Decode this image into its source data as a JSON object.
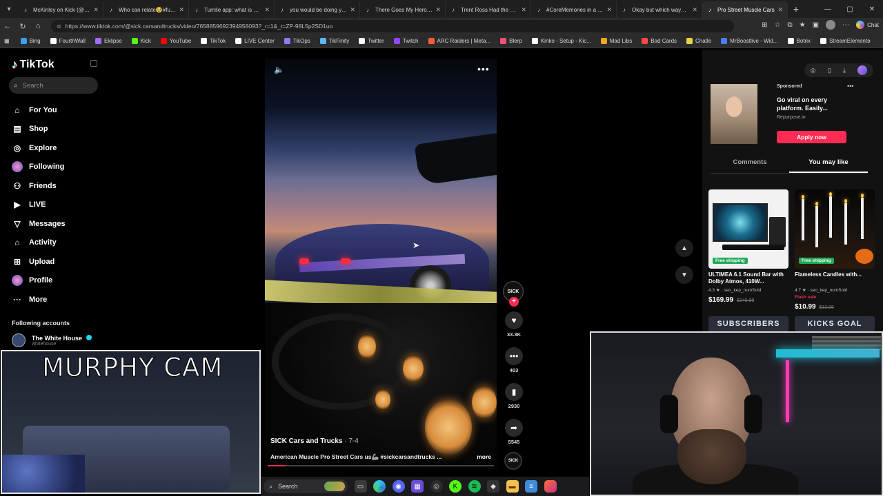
{
  "browser": {
    "tabs": [
      {
        "title": "McKinley on Kick (@mckin",
        "favicon": "tiktok-icon",
        "active": false
      },
      {
        "title": "Who can relate🥹#funny #",
        "favicon": "tiktok-icon",
        "active": false
      },
      {
        "title": "Turnile app: what is Turnil",
        "favicon": "tiktok-icon",
        "active": false
      },
      {
        "title": "you would be doing yours",
        "favicon": "tiktok-icon",
        "active": false
      },
      {
        "title": "There Goes My Hero — Sc",
        "favicon": "tiktok-icon",
        "active": false
      },
      {
        "title": "Trent Ross Had the Wheel",
        "favicon": "tiktok-icon",
        "active": false
      },
      {
        "title": "#CoreMemories in a #Lam",
        "favicon": "tiktok-icon",
        "active": false
      },
      {
        "title": "Okay but which way?? I go",
        "favicon": "tiktok-icon",
        "active": false
      },
      {
        "title": "Pro Street Muscle Cars",
        "favicon": "tiktok-icon",
        "active": true
      }
    ],
    "url": "https://www.tiktok.com/@sick.carsandtrucks/video/7658859692394958093?_r=1&_t=ZP-98L5p2SD1uo",
    "chat_label": "Chat",
    "bookmarks": [
      {
        "label": "Bing",
        "icon": "bing-icon",
        "color": "#3aa0ff"
      },
      {
        "label": "FourthWall",
        "icon": "fourthwall-icon",
        "color": "#ffffff"
      },
      {
        "label": "Eklipse",
        "icon": "eklipse-icon",
        "color": "#a66bff"
      },
      {
        "label": "Kick",
        "icon": "kick-icon",
        "color": "#53fc18"
      },
      {
        "label": "YouTube",
        "icon": "youtube-icon",
        "color": "#ff0000"
      },
      {
        "label": "TikTok",
        "icon": "tiktok-icon",
        "color": "#ffffff"
      },
      {
        "label": "LIVE Center",
        "icon": "tiktok-icon",
        "color": "#ffffff"
      },
      {
        "label": "TikOps",
        "icon": "tikops-icon",
        "color": "#8c7bff"
      },
      {
        "label": "TikFinity",
        "icon": "tikfinity-icon",
        "color": "#5bb8ff"
      },
      {
        "label": "Twitter",
        "icon": "x-icon",
        "color": "#ffffff"
      },
      {
        "label": "Twitch",
        "icon": "twitch-icon",
        "color": "#9146ff"
      },
      {
        "label": "ARC Raiders | Meta...",
        "icon": "arc-icon",
        "color": "#ff5a3c"
      },
      {
        "label": "Blerp",
        "icon": "blerp-icon",
        "color": "#ff4f7a"
      },
      {
        "label": "Kinko - Setup - Kic...",
        "icon": "kinko-icon",
        "color": "#ffffff"
      },
      {
        "label": "Mad Libs",
        "icon": "madlibs-icon",
        "color": "#f6a623"
      },
      {
        "label": "Bad Cards",
        "icon": "badcards-icon",
        "color": "#ff4848"
      },
      {
        "label": "Chatle",
        "icon": "chatle-icon",
        "color": "#e7d34a"
      },
      {
        "label": "MrBoostlive - Wid...",
        "icon": "mrboost-icon",
        "color": "#4a7dff"
      },
      {
        "label": "Botrix",
        "icon": "botrix-icon",
        "color": "#ffffff"
      },
      {
        "label": "StreamElements",
        "icon": "streamelements-icon",
        "color": "#ffffff"
      }
    ]
  },
  "sidebar": {
    "logo": "TikTok",
    "search_placeholder": "Search",
    "nav": [
      {
        "label": "For You",
        "icon": "home-icon"
      },
      {
        "label": "Shop",
        "icon": "shop-icon"
      },
      {
        "label": "Explore",
        "icon": "compass-icon"
      },
      {
        "label": "Following",
        "icon": "following-avatar-icon"
      },
      {
        "label": "Friends",
        "icon": "friends-icon"
      },
      {
        "label": "LIVE",
        "icon": "live-icon"
      },
      {
        "label": "Messages",
        "icon": "messages-icon"
      },
      {
        "label": "Activity",
        "icon": "activity-icon"
      },
      {
        "label": "Upload",
        "icon": "upload-icon"
      },
      {
        "label": "Profile",
        "icon": "profile-avatar-icon"
      },
      {
        "label": "More",
        "icon": "more-icon"
      }
    ],
    "following_header": "Following accounts",
    "following": [
      {
        "name": "The White House",
        "handle": "whitehouse",
        "verified": true
      }
    ]
  },
  "video": {
    "author": "SICK Cars and Trucks",
    "date": "7-4",
    "description": "American Muscle Pro Street Cars us🦾 #sickcarsandtrucks ...",
    "more_label": "more",
    "progress": 0.08,
    "likes": "33.3K",
    "comments": "403",
    "saves": "2930",
    "shares": "5545",
    "avatar_text": "SICK"
  },
  "right_panel": {
    "ad": {
      "sponsored": "Sponsored",
      "title": "Go viral on every platform. Easily...",
      "site": "Repurpose.io",
      "cta": "Apply now"
    },
    "tabs": [
      {
        "label": "Comments",
        "active": false
      },
      {
        "label": "You may like",
        "active": true
      }
    ],
    "products": [
      {
        "badge": "Free shipping",
        "name": "ULTIMEA 6.1 Sound Bar with Dolby Atmos, 410W...",
        "rating": "4.3 ★ · seo_kep_numSold",
        "sale": "",
        "price": "$169.99",
        "old_price": "$249.99"
      },
      {
        "badge": "Free shipping",
        "name": "Flameless Candles with...",
        "rating": "4.7 ★ · seo_kep_numSold",
        "sale": "Flash sale",
        "price": "$10.99",
        "old_price": "$13.99"
      }
    ]
  },
  "overlays": {
    "subs_goal": "SUBSCRIBERS",
    "kicks_goal": "KICKS GOAL",
    "pet_cam_title": "MURPHY CAM"
  },
  "taskbar": {
    "search_label": "Search"
  },
  "colors": {
    "accent": "#fe2c55",
    "cyan": "#25f4ee",
    "ship_green": "#1faa59"
  }
}
